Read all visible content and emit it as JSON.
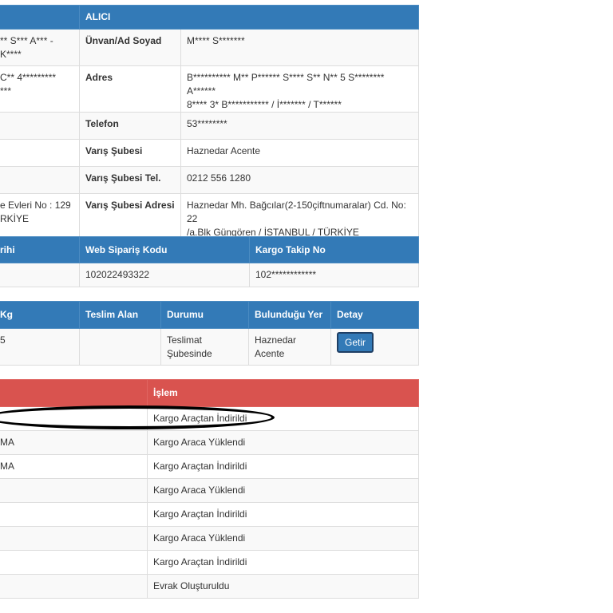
{
  "receiver_table": {
    "header": "ALICI",
    "rows": [
      {
        "left": "** S*** A*** - K****",
        "label": "Ünvan/Ad Soyad",
        "value": "M**** S*******"
      },
      {
        "left": "C** 4*********\n***",
        "label": "Adres",
        "value": "B********** M** P****** S**** S** N** 5 S******** A******\n8**** 3* B*********** / İ******* / T******"
      },
      {
        "left": "",
        "label": "Telefon",
        "value": "53********"
      },
      {
        "left": "",
        "label": "Varış Şubesi",
        "value": "Haznedar Acente"
      },
      {
        "left": "",
        "label": "Varış Şubesi Tel.",
        "value": "0212 556 1280"
      },
      {
        "left": "e Evleri No : 129\nRKİYE",
        "label": "Varış Şubesi Adresi",
        "value": "Haznedar Mh. Bağcılar(2-150çiftnumaralar) Cd. No: 22\n/a.Blk Güngören / İSTANBUL / TÜRKİYE"
      }
    ]
  },
  "order_table": {
    "headers": [
      "rihi",
      "Web Sipariş Kodu",
      "Kargo Takip No"
    ],
    "row": [
      "",
      "102022493322",
      "102************"
    ]
  },
  "status_table": {
    "headers": [
      "Kg",
      "Teslim Alan",
      "Durumu",
      "Bulunduğu Yer",
      "Detay"
    ],
    "row": [
      "5",
      "",
      "Teslimat\nŞubesinde",
      "Haznedar Acente"
    ],
    "button_label": "Getir"
  },
  "history_table": {
    "headers": [
      "",
      "İşlem"
    ],
    "rows": [
      {
        "left": "",
        "action": "Kargo Araçtan İndirildi"
      },
      {
        "left": "MA",
        "action": "Kargo Araca Yüklendi"
      },
      {
        "left": "MA",
        "action": "Kargo Araçtan İndirildi"
      },
      {
        "left": "",
        "action": "Kargo Araca Yüklendi"
      },
      {
        "left": "",
        "action": "Kargo Araçtan İndirildi"
      },
      {
        "left": "",
        "action": "Kargo Araca Yüklendi"
      },
      {
        "left": "",
        "action": "Kargo Araçtan İndirildi"
      },
      {
        "left": "",
        "action": "Evrak Oluşturuldu"
      }
    ]
  }
}
